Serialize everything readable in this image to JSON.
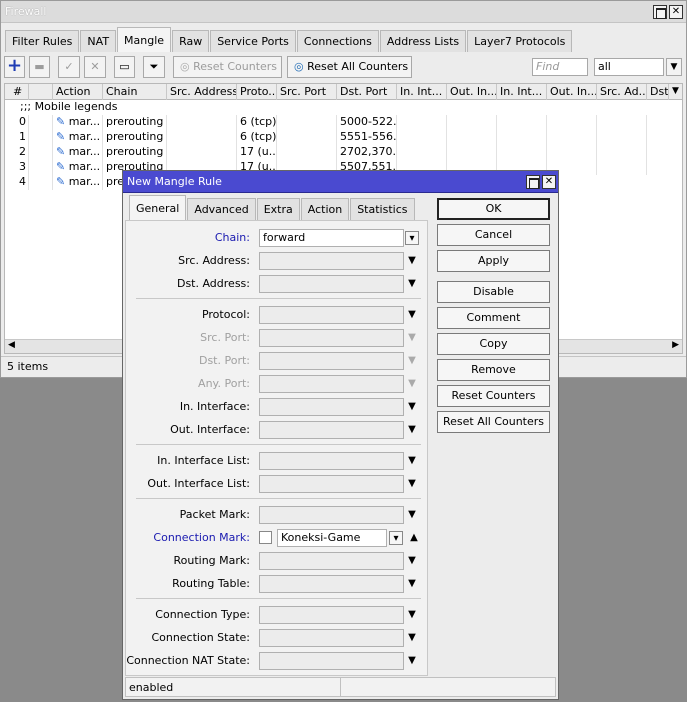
{
  "firewall": {
    "title": "Firewall",
    "tabs": [
      "Filter Rules",
      "NAT",
      "Mangle",
      "Raw",
      "Service Ports",
      "Connections",
      "Address Lists",
      "Layer7 Protocols"
    ],
    "active_tab": "Mangle",
    "toolbar": {
      "reset_counters": "Reset Counters",
      "reset_all_counters": "Reset All Counters",
      "find_placeholder": "Find",
      "filter_value": "all"
    },
    "columns": [
      "#",
      "Action",
      "Chain",
      "Src. Address",
      "Proto...",
      "Src. Port",
      "Dst. Port",
      "In. Int...",
      "Out. In...",
      "In. Int...",
      "Out. In...",
      "Src. Ad...",
      "Dst"
    ],
    "group_comment": ";;; Mobile legends",
    "rows": [
      {
        "num": "0",
        "action": "mar...",
        "chain": "prerouting",
        "proto": "6 (tcp)",
        "dst_port": "5000-522..."
      },
      {
        "num": "1",
        "action": "mar...",
        "chain": "prerouting",
        "proto": "6 (tcp)",
        "dst_port": "5551-556..."
      },
      {
        "num": "2",
        "action": "mar...",
        "chain": "prerouting",
        "proto": "17 (u...",
        "dst_port": "2702,370..."
      },
      {
        "num": "3",
        "action": "mar...",
        "chain": "prerouting",
        "proto": "17 (u...",
        "dst_port": "5507,551..."
      },
      {
        "num": "4",
        "action": "mar...",
        "chain": "prer",
        "proto": "",
        "dst_port": ""
      }
    ],
    "status_text": "5 items"
  },
  "dialog": {
    "title": "New Mangle Rule",
    "tabs": [
      "General",
      "Advanced",
      "Extra",
      "Action",
      "Statistics"
    ],
    "active_tab": "General",
    "fields": {
      "chain_label": "Chain:",
      "chain_value": "forward",
      "src_address_label": "Src. Address:",
      "dst_address_label": "Dst. Address:",
      "protocol_label": "Protocol:",
      "src_port_label": "Src. Port:",
      "dst_port_label": "Dst. Port:",
      "any_port_label": "Any. Port:",
      "in_interface_label": "In. Interface:",
      "out_interface_label": "Out. Interface:",
      "in_interface_list_label": "In. Interface List:",
      "out_interface_list_label": "Out. Interface List:",
      "packet_mark_label": "Packet Mark:",
      "connection_mark_label": "Connection Mark:",
      "connection_mark_value": "Koneksi-Game",
      "routing_mark_label": "Routing Mark:",
      "routing_table_label": "Routing Table:",
      "connection_type_label": "Connection Type:",
      "connection_state_label": "Connection State:",
      "connection_nat_state_label": "Connection NAT State:"
    },
    "buttons": {
      "ok": "OK",
      "cancel": "Cancel",
      "apply": "Apply",
      "disable": "Disable",
      "comment": "Comment",
      "copy": "Copy",
      "remove": "Remove",
      "reset_counters": "Reset Counters",
      "reset_all_counters": "Reset All Counters"
    },
    "status_text": "enabled"
  },
  "colors": {
    "dialog_titlebar": "#4a4ad0",
    "label_highlight": "#1a1ab0",
    "add_icon": "#1e3cb4"
  }
}
